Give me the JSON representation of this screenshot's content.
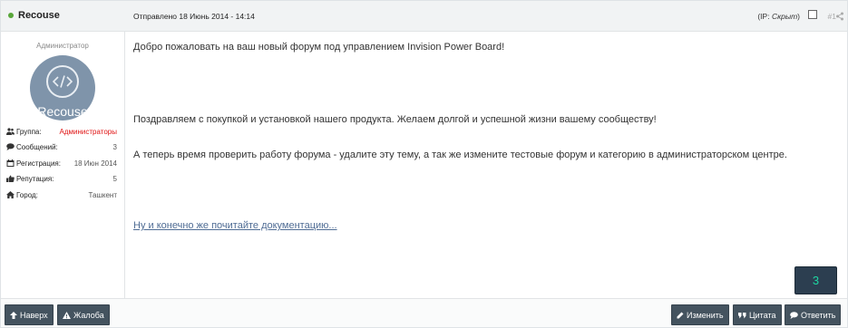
{
  "header": {
    "author": "Recouse",
    "date": "Отправлено 18 Июнь 2014 - 14:14",
    "ip_prefix": "(IP: ",
    "ip_value": "Скрыт",
    "ip_suffix": ")",
    "post_number": "#1"
  },
  "sidebar": {
    "role": "Администратор",
    "avatar_name": "Recouse",
    "info": [
      {
        "label": "Группа:",
        "value": "Администраторы",
        "icon": "users-icon"
      },
      {
        "label": "Сообщений:",
        "value": "3",
        "icon": "comment-icon"
      },
      {
        "label": "Регистрация:",
        "value": "18 Июн 2014",
        "icon": "calendar-icon"
      },
      {
        "label": "Репутация:",
        "value": "5",
        "icon": "thumbs-up-icon"
      },
      {
        "label": "Город:",
        "value": "Ташкент",
        "icon": "home-icon"
      }
    ]
  },
  "content": {
    "p1": "Добро пожаловать на ваш новый форум под управлением Invision Power Board!",
    "p2": "Поздравляем с покупкой и установкой нашего продукта. Желаем долгой и успешной жизни вашему сообществу!",
    "p3": "А теперь время проверить работу форума - удалите эту тему, а так же измените тестовые форум и категорию в администраторском центре.",
    "link": "Ну и конечно же почитайте документацию..."
  },
  "reputation_badge": "3",
  "footer": {
    "up": "Наверх",
    "report": "Жалоба",
    "edit": "Изменить",
    "quote": "Цитата",
    "reply": "Ответить"
  },
  "colors": {
    "online": "#58a63a",
    "button": "#44535f",
    "group_value": "#e01414",
    "badge_bg": "#2c3e50",
    "badge_text": "#1ed6a2",
    "link": "#4f6c94"
  }
}
